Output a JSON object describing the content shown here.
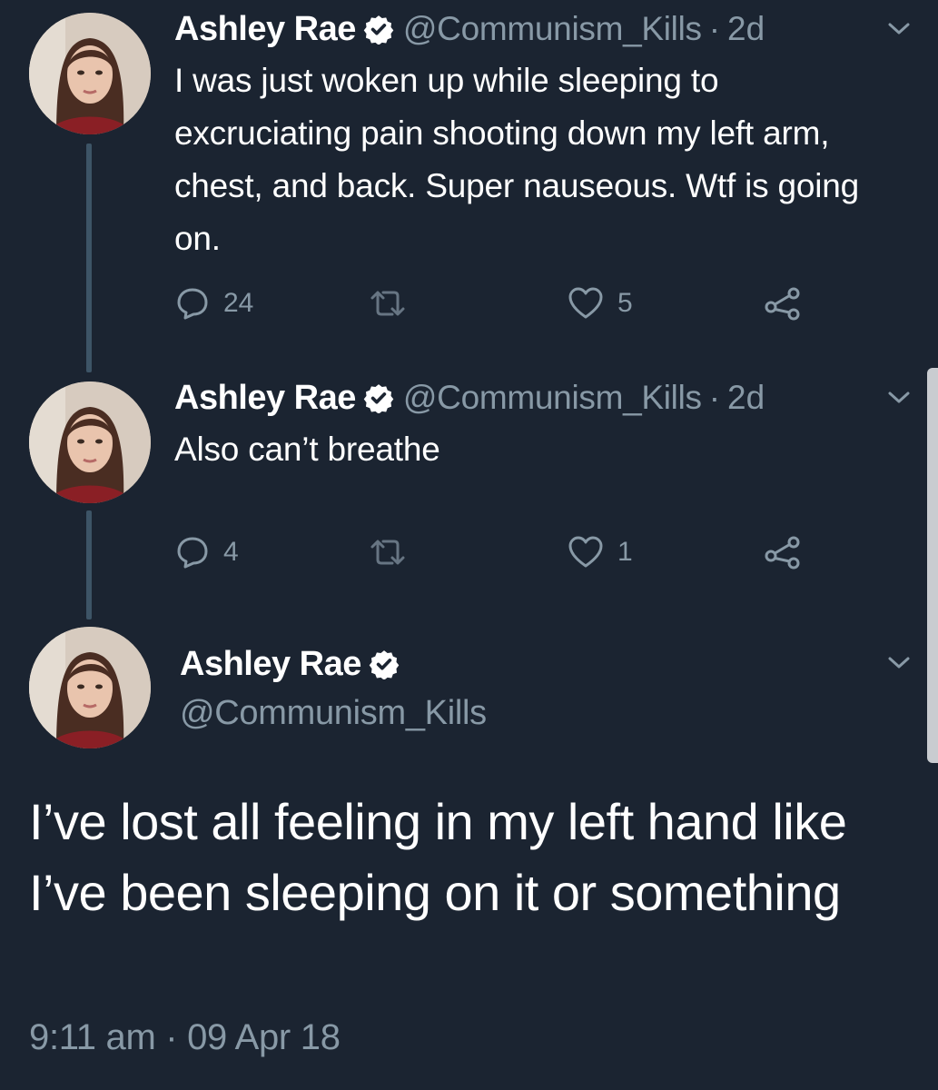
{
  "tweets": [
    {
      "name": "Ashley Rae",
      "handle": "@Communism_Kills",
      "separator": "·",
      "time": "2d",
      "text": "I was just woken up while sleeping to excruciating pain shooting down my left arm, chest, and back. Super nauseous. Wtf is going on.",
      "replies": "24",
      "retweets": "",
      "likes": "5"
    },
    {
      "name": "Ashley Rae",
      "handle": "@Communism_Kills",
      "separator": "·",
      "time": "2d",
      "text": "Also can’t breathe",
      "replies": "4",
      "retweets": "",
      "likes": "1"
    }
  ],
  "main_tweet": {
    "name": "Ashley Rae",
    "handle": "@Communism_Kills",
    "text": "I’ve lost all feeling in my left hand like I’ve been sleeping on it or something",
    "timestamp": "9:11 am · 09 Apr 18"
  },
  "icons": {
    "verified": "verified-badge-icon",
    "menu": "chevron-down-icon",
    "reply": "reply-icon",
    "retweet": "retweet-icon",
    "like": "heart-icon",
    "share": "share-icon"
  },
  "colors": {
    "background": "#1b2431",
    "text_primary": "#ffffff",
    "text_secondary": "#8899a6",
    "thread_line": "#3d5466"
  }
}
